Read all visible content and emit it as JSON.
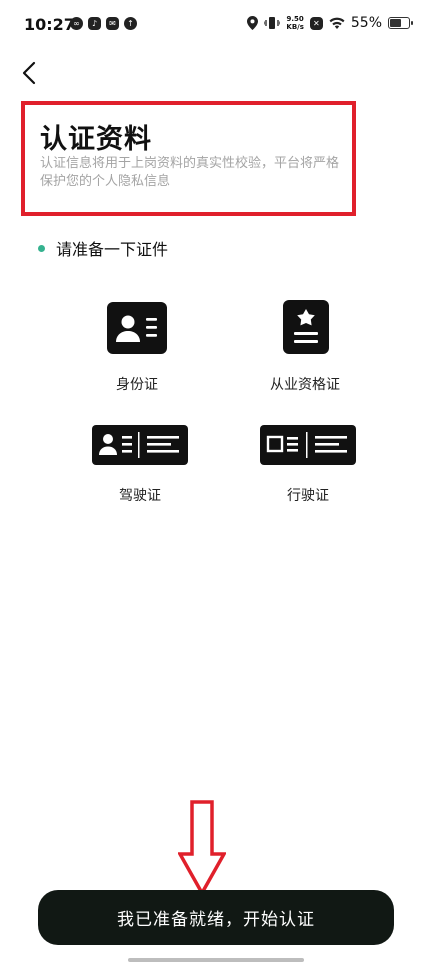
{
  "status_bar": {
    "time": "10:27",
    "speed_value": "9.50",
    "speed_unit": "KB/s",
    "battery": "55%"
  },
  "header": {
    "title": "认证资料",
    "description": "认证信息将用于上岗资料的真实性校验，平台将严格保护您的个人隐私信息"
  },
  "section": {
    "prepare_label": "请准备一下证件"
  },
  "documents": [
    {
      "label": "身份证",
      "icon": "id-card-icon"
    },
    {
      "label": "从业资格证",
      "icon": "qualification-certificate-icon"
    },
    {
      "label": "驾驶证",
      "icon": "driver-license-icon"
    },
    {
      "label": "行驶证",
      "icon": "vehicle-license-icon"
    }
  ],
  "footer": {
    "start_button_label": "我已准备就绪，开始认证"
  },
  "colors": {
    "accent": "#35b28f",
    "annotation_red": "#e0202b",
    "button_bg": "#111814"
  }
}
